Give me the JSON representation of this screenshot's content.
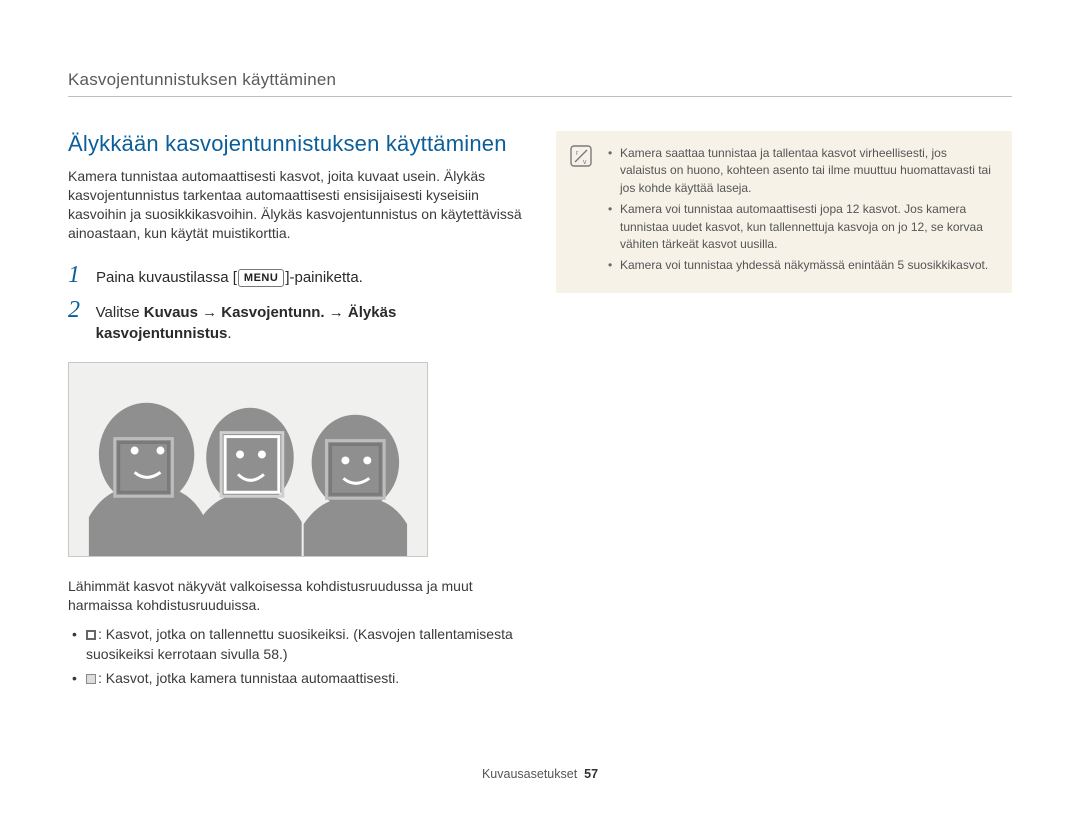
{
  "runningHead": "Kasvojentunnistuksen käyttäminen",
  "sectionTitle": "Älykkään kasvojentunnistuksen käyttäminen",
  "intro": "Kamera tunnistaa automaattisesti kasvot, joita kuvaat usein. Älykäs kasvojentunnistus tarkentaa automaattisesti ensisijaisesti kyseisiin kasvoihin ja suosikkikasvoihin. Älykäs kasvojentunnistus on käytettävissä ainoastaan, kun käytät muistikorttia.",
  "steps": {
    "s1": {
      "num": "1",
      "pre": "Paina kuvaustilassa [",
      "badge": "MENU",
      "post": "]-painiketta."
    },
    "s2": {
      "num": "2",
      "pre": "Valitse ",
      "bold": "Kuvaus → Kasvojentunn. → Älykäs kasvojentunnistus",
      "post": "."
    }
  },
  "caption": "Lähimmät kasvot näkyvät valkoisessa kohdistusruudussa ja muut harmaissa kohdistusruuduissa.",
  "legend": {
    "white": ": Kasvot, jotka on tallennettu suosikeiksi. (Kasvojen tallentamisesta suosikeiksi kerrotaan sivulla 58.)",
    "grey": ": Kasvot, jotka kamera tunnistaa automaattisesti."
  },
  "notes": {
    "n1": "Kamera saattaa tunnistaa ja tallentaa kasvot virheellisesti, jos valaistus on huono, kohteen asento tai ilme muuttuu huomattavasti tai jos kohde käyttää laseja.",
    "n2": "Kamera voi tunnistaa automaattisesti jopa 12 kasvot. Jos kamera tunnistaa uudet kasvot, kun tallennettuja kasvoja on jo 12, se korvaa vähiten tärkeät kasvot uusilla.",
    "n3": "Kamera voi tunnistaa yhdessä näkymässä enintään 5 suosikkikasvot."
  },
  "footer": {
    "label": "Kuvausasetukset",
    "page": "57"
  }
}
